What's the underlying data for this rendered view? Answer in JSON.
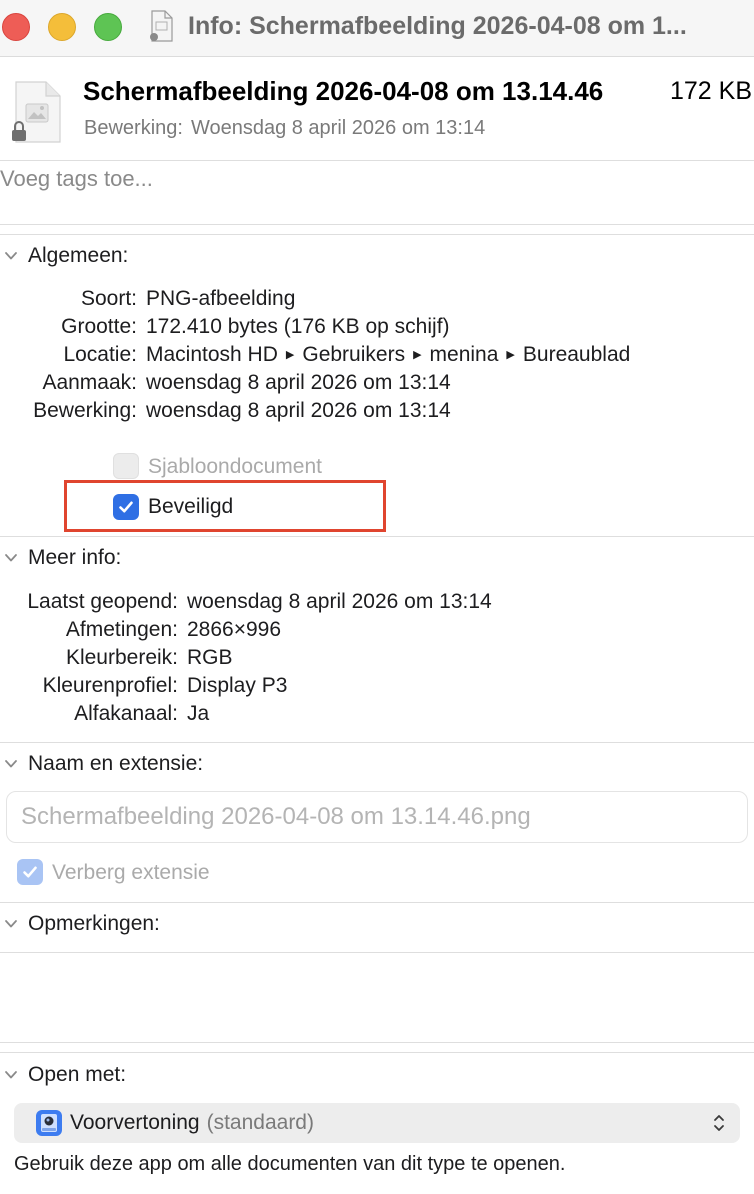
{
  "window": {
    "title": "Info: Schermafbeelding 2026-04-08 om 1..."
  },
  "header": {
    "filename": "Schermafbeelding 2026-04-08 om 13.14.46",
    "size": "172 KB",
    "modified_label": "Bewerking:",
    "modified_value": "Woensdag 8 april 2026 om 13:14"
  },
  "tags": {
    "placeholder": "Voeg tags toe..."
  },
  "general": {
    "title": "Algemeen:",
    "rows": [
      {
        "key": "Soort:",
        "value": "PNG-afbeelding"
      },
      {
        "key": "Grootte:",
        "value": "172.410 bytes (176 KB op schijf)"
      },
      {
        "key": "Locatie:",
        "path": [
          "Macintosh HD",
          "Gebruikers",
          "menina",
          "Bureaublad"
        ]
      },
      {
        "key": "Aanmaak:",
        "value": "woensdag 8 april 2026 om 13:14"
      },
      {
        "key": "Bewerking:",
        "value": "woensdag 8 april 2026 om 13:14"
      }
    ],
    "template_label": "Sjabloondocument",
    "template_checked": false,
    "locked_label": "Beveiligd",
    "locked_checked": true
  },
  "more_info": {
    "title": "Meer info:",
    "rows": [
      {
        "key": "Laatst geopend:",
        "value": "woensdag 8 april 2026 om 13:14"
      },
      {
        "key": "Afmetingen:",
        "value": "2866×996"
      },
      {
        "key": "Kleurbereik:",
        "value": "RGB"
      },
      {
        "key": "Kleurenprofiel:",
        "value": "Display P3"
      },
      {
        "key": "Alfakanaal:",
        "value": "Ja"
      }
    ]
  },
  "name_ext": {
    "title": "Naam en extensie:",
    "value": "Schermafbeelding 2026-04-08 om 13.14.46.png",
    "hide_ext_label": "Verberg extensie",
    "hide_ext_checked": true
  },
  "comments": {
    "title": "Opmerkingen:"
  },
  "open_with": {
    "title": "Open met:",
    "app_name": "Voorvertoning",
    "app_default": "(standaard)",
    "note": "Gebruik deze app om alle documenten van dit type te openen."
  },
  "colors": {
    "accent": "#2f6fe4",
    "highlight": "#e0452f"
  }
}
